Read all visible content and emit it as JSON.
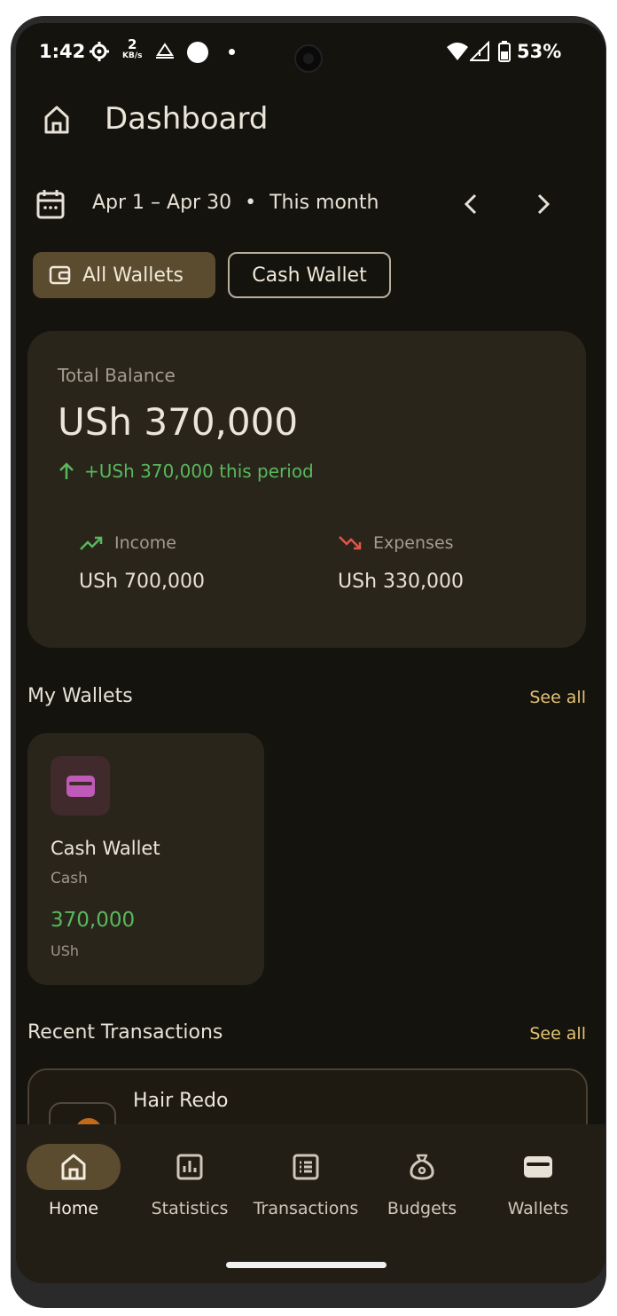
{
  "status_bar": {
    "time": "1:42",
    "net_speed_value": "2",
    "net_speed_unit": "KB/s",
    "battery": "53%"
  },
  "header": {
    "title": "Dashboard"
  },
  "date_range": {
    "range": "Apr 1 – Apr 30",
    "separator": "•",
    "period": "This month"
  },
  "wallet_filters": {
    "all_label": "All Wallets",
    "cash_label": "Cash Wallet",
    "selected": "All Wallets"
  },
  "balance": {
    "label": "Total Balance",
    "value": "USh 370,000",
    "change": "+USh 370,000 this period",
    "income_label": "Income",
    "income_value": "USh 700,000",
    "expenses_label": "Expenses",
    "expenses_value": "USh 330,000"
  },
  "wallets_section": {
    "title": "My Wallets",
    "see_all": "See all",
    "items": [
      {
        "name": "Cash Wallet",
        "type": "Cash",
        "amount": "370,000",
        "currency": "USh"
      }
    ]
  },
  "transactions_section": {
    "title": "Recent Transactions",
    "see_all": "See all",
    "items": [
      {
        "name": "Hair Redo"
      }
    ]
  },
  "bottom_nav": {
    "items": [
      {
        "label": "Home",
        "icon": "home-icon",
        "active": true
      },
      {
        "label": "Statistics",
        "icon": "bar-chart-icon",
        "active": false
      },
      {
        "label": "Transactions",
        "icon": "list-icon",
        "active": false
      },
      {
        "label": "Budgets",
        "icon": "money-bag-icon",
        "active": false
      },
      {
        "label": "Wallets",
        "icon": "wallet-icon",
        "active": false
      }
    ]
  },
  "colors": {
    "background": "#15130e",
    "card": "#2a251b",
    "accent": "#e3c372",
    "chip_active": "#5b4c30",
    "positive": "#58b85c",
    "negative": "#e05548",
    "wallet_icon": "#c05ab8"
  }
}
